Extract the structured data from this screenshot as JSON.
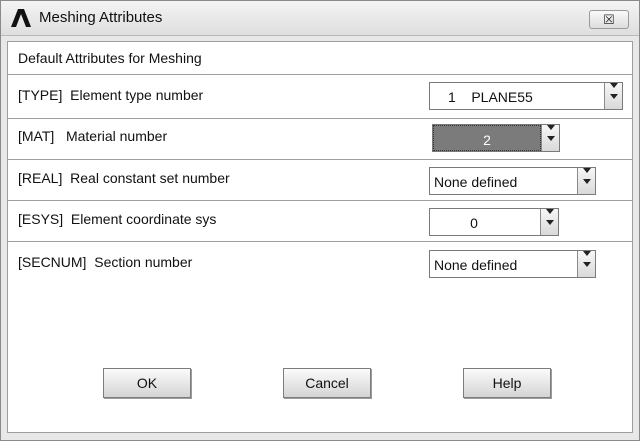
{
  "window": {
    "title": "Meshing Attributes",
    "close_glyph": "☒",
    "logo_icon": "ansys-logo-icon"
  },
  "dialog": {
    "heading": "Default Attributes for Meshing"
  },
  "fields": [
    {
      "label": "[TYPE]  Element type number",
      "value": "1    PLANE55"
    },
    {
      "label": "[MAT]   Material number",
      "value": "2"
    },
    {
      "label": "[REAL]  Real constant set number",
      "value": "None defined"
    },
    {
      "label": "[ESYS]  Element coordinate sys",
      "value": "0"
    },
    {
      "label": "[SECNUM]  Section number",
      "value": "None defined"
    }
  ],
  "buttons": {
    "ok": "OK",
    "cancel": "Cancel",
    "help": "Help"
  }
}
